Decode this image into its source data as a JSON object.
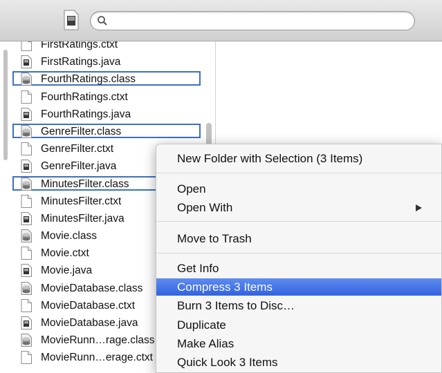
{
  "search": {
    "value": "",
    "placeholder": ""
  },
  "files": [
    {
      "name": "FirstRatings.ctxt",
      "kind": "doc",
      "selected": false
    },
    {
      "name": "FirstRatings.java",
      "kind": "java",
      "selected": false
    },
    {
      "name": "FourthRatings.class",
      "kind": "class",
      "selected": true
    },
    {
      "name": "FourthRatings.ctxt",
      "kind": "doc",
      "selected": false
    },
    {
      "name": "FourthRatings.java",
      "kind": "java",
      "selected": false
    },
    {
      "name": "GenreFilter.class",
      "kind": "class",
      "selected": true
    },
    {
      "name": "GenreFilter.ctxt",
      "kind": "doc",
      "selected": false
    },
    {
      "name": "GenreFilter.java",
      "kind": "java",
      "selected": false
    },
    {
      "name": "MinutesFilter.class",
      "kind": "class",
      "selected": true
    },
    {
      "name": "MinutesFilter.ctxt",
      "kind": "doc",
      "selected": false
    },
    {
      "name": "MinutesFilter.java",
      "kind": "java",
      "selected": false
    },
    {
      "name": "Movie.class",
      "kind": "class",
      "selected": false
    },
    {
      "name": "Movie.ctxt",
      "kind": "doc",
      "selected": false
    },
    {
      "name": "Movie.java",
      "kind": "java",
      "selected": false
    },
    {
      "name": "MovieDatabase.class",
      "kind": "class",
      "selected": false
    },
    {
      "name": "MovieDatabase.ctxt",
      "kind": "doc",
      "selected": false
    },
    {
      "name": "MovieDatabase.java",
      "kind": "java",
      "selected": false
    },
    {
      "name": "MovieRunn…rage.class",
      "kind": "class",
      "selected": false
    },
    {
      "name": "MovieRunn…erage.ctxt",
      "kind": "doc",
      "selected": false
    }
  ],
  "context_menu": {
    "new_folder": "New Folder with Selection (3 Items)",
    "open": "Open",
    "open_with": "Open With",
    "move_to_trash": "Move to Trash",
    "get_info": "Get Info",
    "compress": "Compress 3 Items",
    "burn": "Burn 3 Items to Disc…",
    "duplicate": "Duplicate",
    "make_alias": "Make Alias",
    "quick_look": "Quick Look 3 Items"
  },
  "colors": {
    "selection_outline": "#3d6fc4",
    "menu_highlight": "#3a6ae2"
  }
}
